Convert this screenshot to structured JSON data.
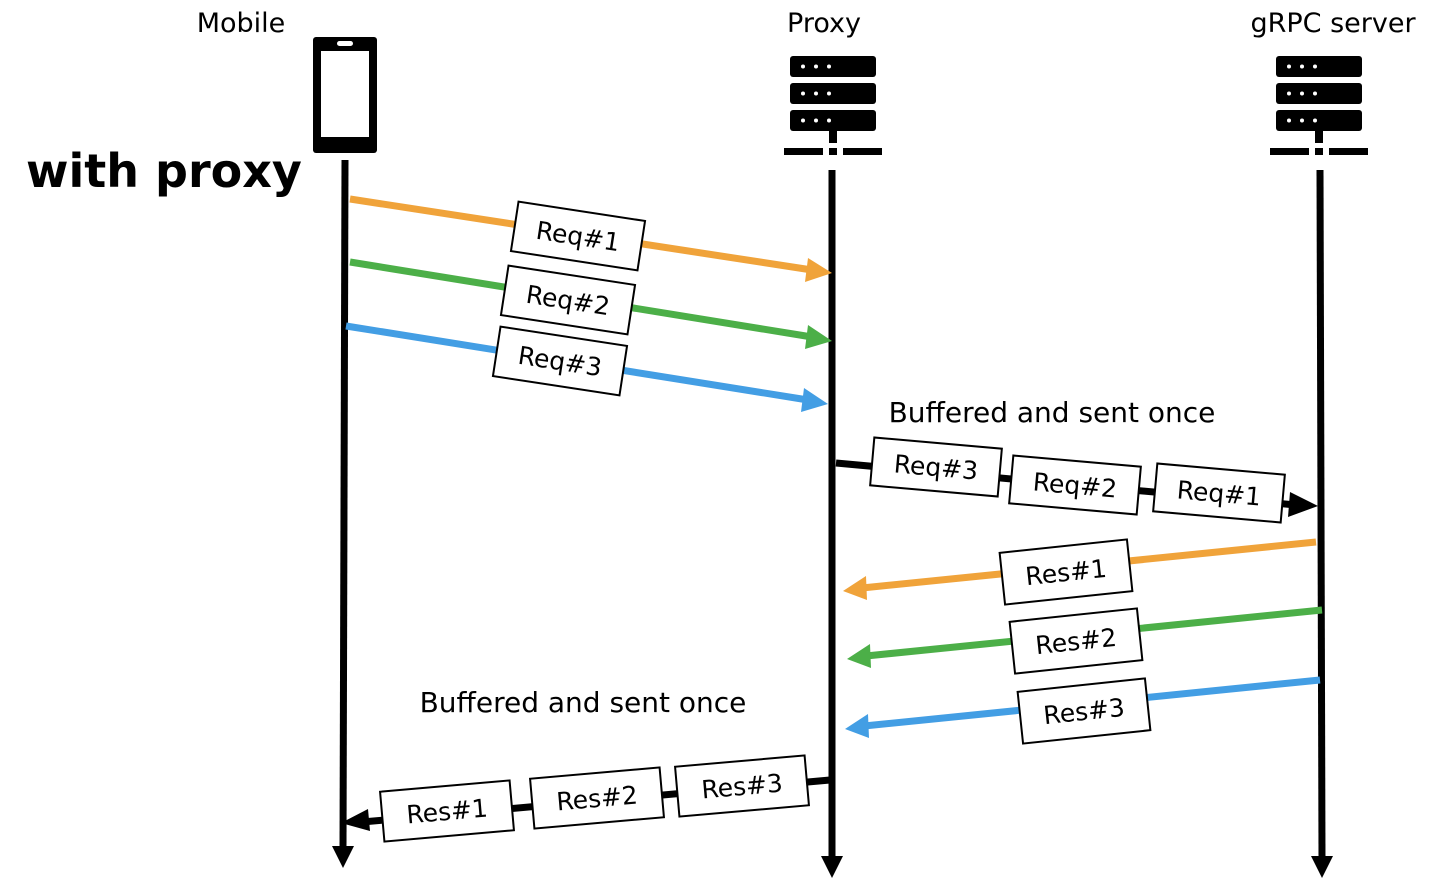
{
  "title": "with proxy",
  "colors": {
    "req1": "#f0a33a",
    "req2": "#4caf48",
    "req3": "#439ee4",
    "line": "#000000"
  },
  "participants": [
    {
      "id": "mobile",
      "label": "Mobile",
      "icon": "phone-icon"
    },
    {
      "id": "proxy",
      "label": "Proxy",
      "icon": "server-icon"
    },
    {
      "id": "server",
      "label": "gRPC server",
      "icon": "server-icon"
    }
  ],
  "messages": {
    "requests": [
      {
        "label": "Req#1",
        "from": "mobile",
        "to": "proxy",
        "color": "req1"
      },
      {
        "label": "Req#2",
        "from": "mobile",
        "to": "proxy",
        "color": "req2"
      },
      {
        "label": "Req#3",
        "from": "mobile",
        "to": "proxy",
        "color": "req3"
      }
    ],
    "batched_requests": {
      "from": "proxy",
      "to": "server",
      "labels": [
        "Req#3",
        "Req#2",
        "Req#1"
      ]
    },
    "responses": [
      {
        "label": "Res#1",
        "from": "server",
        "to": "proxy",
        "color": "req1"
      },
      {
        "label": "Res#2",
        "from": "server",
        "to": "proxy",
        "color": "req2"
      },
      {
        "label": "Res#3",
        "from": "server",
        "to": "proxy",
        "color": "req3"
      }
    ],
    "batched_responses": {
      "from": "proxy",
      "to": "mobile",
      "labels": [
        "Res#1",
        "Res#2",
        "Res#3"
      ]
    }
  },
  "notes": {
    "proxy_to_server": "Buffered and sent once",
    "proxy_to_mobile": "Buffered and sent once"
  }
}
